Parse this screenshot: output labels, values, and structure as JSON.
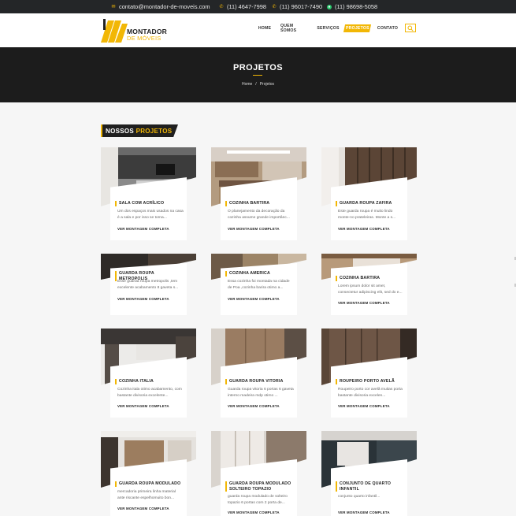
{
  "topbar": {
    "email": "contato@montador-de-moveis.com",
    "phone1": "(11) 4647-7998",
    "phone2": "(11) 96017-7490",
    "whatsapp": "(11) 98698-5058",
    "icons": [
      "mail-icon",
      "phone-icon",
      "phone-icon",
      "whatsapp-icon"
    ],
    "accent": "#f2b705"
  },
  "header": {
    "logo_line1": "MONTADOR",
    "logo_line2": "DE MÓVEIS",
    "nav": [
      "HOME",
      "QUEM SOMOS",
      "SERVIÇOS",
      "PROJETOS",
      "CONTATO"
    ],
    "active_nav": "PROJETOS"
  },
  "hero": {
    "title": "PROJETOS",
    "breadcrumb_home": "Home",
    "breadcrumb_sep": "/",
    "breadcrumb_current": "Projetos"
  },
  "section": {
    "title_part1": "NOSSOS",
    "title_part2": "PROJETOS"
  },
  "cards": [
    {
      "title": "SALA COM ACRÍLICO",
      "desc": "Um dos espaços mais usados na casa é a sala e por isso se torna...",
      "link": "VER MONTAGEM COMPLETA"
    },
    {
      "title": "COZINHA BARTIRA",
      "desc": "O planejamento da decoração da cozinha assume grande importânc...",
      "link": "VER MONTAGEM COMPLETA"
    },
    {
      "title": "GUARDA ROUPA ZAFIRA",
      "desc": "Este guarda roupa é muito lindo monte-no prateleiras. Monte a s...",
      "link": "VER MONTAGEM COMPLETA"
    },
    {
      "title": "GUARDA ROUPA METROPOLIS",
      "desc": "Esse guarda roupa metropolis ,tem excelente acabamento 8 gaveta s...",
      "link": "VER MONTAGEM COMPLETA"
    },
    {
      "title": "COZINHA AMERICA",
      "desc": "Essa cozinha foi montada na cidade de Poa ,cozinha barira otimo a...",
      "link": "VER MONTAGEM COMPLETA"
    },
    {
      "title": "COZINHA BARTIRA",
      "desc": "Lorem ipsum dolor sit amet, consectetur adipiscing elit, sed do e...",
      "link": "VER MONTAGEM COMPLETA"
    },
    {
      "title": "COZINHA ITALIA",
      "desc": "Cozinha itala otimo acabamento, com bastante divisoria excelente...",
      "link": "VER MONTAGEM COMPLETA"
    },
    {
      "title": "GUARDA ROUPA VITORIA",
      "desc": "Guarda roupa vitoria 6 portas 6 gaveta interno madeira mdp otimo ...",
      "link": "VER MONTAGEM COMPLETA"
    },
    {
      "title": "ROUPEIRO PORTO AVELÃ",
      "desc": "Roupeiro porto cor avelã muitas porta bastante divisoria excelen...",
      "link": "VER MONTAGEM COMPLETA"
    },
    {
      "title": "GUARDA ROUPA MODULADO",
      "desc": "mercadoria primeira linha material ante riscante espelhomuito bon...",
      "link": "VER MONTAGEM COMPLETA"
    },
    {
      "title": "GUARDA ROUPA MODULADO SOLTEIRO TOPAZIO",
      "desc": "guarda roupa modulado de solteiro topazio 6 portas com 2 porta de...",
      "link": "VER MONTAGEM COMPLETA"
    },
    {
      "title": "CONJUNTO DE QUARTO INFANTIL",
      "desc": "conjunto quarto infantil...",
      "link": "VER MONTAGEM COMPLETA"
    }
  ]
}
